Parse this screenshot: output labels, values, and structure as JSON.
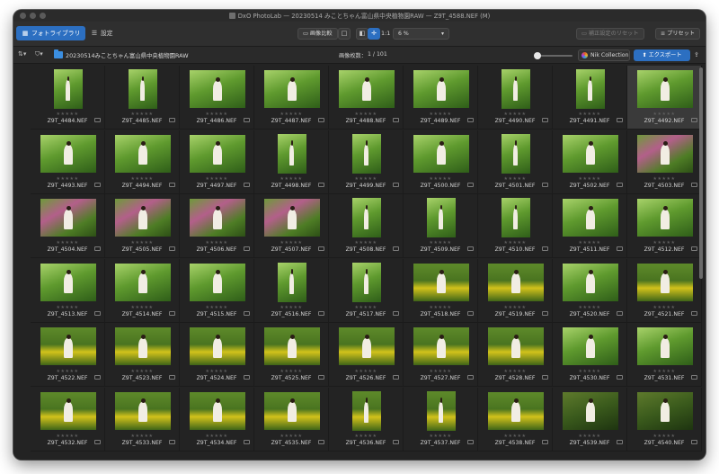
{
  "window": {
    "title": "DxO PhotoLab — 20230514 みことちゃん富山県中央植物園RAW — Z9T_4588.NEF (M)"
  },
  "toolbar": {
    "tab_library": "フォトライブラリ",
    "tab_customize": "設定",
    "compare_label": "画像比較",
    "zoom_one": "1:1",
    "zoom_value": "6 %",
    "reset_label": "補正設定のリセット",
    "presets_label": "プリセット"
  },
  "pathbar": {
    "path": "20230514みことちゃん富山県中央植物園RAW",
    "count_label": "画像枚数：",
    "count_value": "1 / 101",
    "nik_label": "Nik Collection",
    "export_label": "エクスポート"
  },
  "grid": {
    "stars": "★★★★★",
    "rows": [
      [
        "Z9T_4484.NEF",
        "Z9T_4485.NEF",
        "Z9T_4486.NEF",
        "Z9T_4487.NEF",
        "Z9T_4488.NEF",
        "Z9T_4489.NEF",
        "Z9T_4490.NEF",
        "Z9T_4491.NEF",
        "Z9T_4492.NEF"
      ],
      [
        "Z9T_4493.NEF",
        "Z9T_4494.NEF",
        "Z9T_4497.NEF",
        "Z9T_4498.NEF",
        "Z9T_4499.NEF",
        "Z9T_4500.NEF",
        "Z9T_4501.NEF",
        "Z9T_4502.NEF",
        "Z9T_4503.NEF"
      ],
      [
        "Z9T_4504.NEF",
        "Z9T_4505.NEF",
        "Z9T_4506.NEF",
        "Z9T_4507.NEF",
        "Z9T_4508.NEF",
        "Z9T_4509.NEF",
        "Z9T_4510.NEF",
        "Z9T_4511.NEF",
        "Z9T_4512.NEF"
      ],
      [
        "Z9T_4513.NEF",
        "Z9T_4514.NEF",
        "Z9T_4515.NEF",
        "Z9T_4516.NEF",
        "Z9T_4517.NEF",
        "Z9T_4518.NEF",
        "Z9T_4519.NEF",
        "Z9T_4520.NEF",
        "Z9T_4521.NEF"
      ],
      [
        "Z9T_4522.NEF",
        "Z9T_4523.NEF",
        "Z9T_4524.NEF",
        "Z9T_4525.NEF",
        "Z9T_4526.NEF",
        "Z9T_4527.NEF",
        "Z9T_4528.NEF",
        "Z9T_4530.NEF",
        "Z9T_4531.NEF"
      ],
      [
        "Z9T_4532.NEF",
        "Z9T_4533.NEF",
        "Z9T_4534.NEF",
        "Z9T_4535.NEF",
        "Z9T_4536.NEF",
        "Z9T_4537.NEF",
        "Z9T_4538.NEF",
        "Z9T_4539.NEF",
        "Z9T_4540.NEF"
      ]
    ],
    "orientation": [
      [
        "v",
        "v",
        "h",
        "h",
        "h",
        "h",
        "v",
        "v",
        "h"
      ],
      [
        "h",
        "h",
        "h",
        "v",
        "v",
        "h",
        "v",
        "h",
        "h"
      ],
      [
        "h",
        "h",
        "h",
        "h",
        "v",
        "v",
        "v",
        "h",
        "h"
      ],
      [
        "h",
        "h",
        "h",
        "v",
        "v",
        "h",
        "h",
        "h",
        "h"
      ],
      [
        "h",
        "h",
        "h",
        "h",
        "h",
        "h",
        "h",
        "h",
        "h"
      ],
      [
        "h",
        "h",
        "h",
        "h",
        "v",
        "v",
        "h",
        "h",
        "h"
      ]
    ],
    "theme": [
      [
        "green",
        "green",
        "green",
        "green",
        "green",
        "green",
        "green",
        "green",
        "green"
      ],
      [
        "green",
        "green",
        "green",
        "green",
        "green",
        "green",
        "green",
        "green",
        "pink"
      ],
      [
        "pink",
        "pink",
        "pink",
        "pink",
        "green",
        "green",
        "green",
        "green",
        "green"
      ],
      [
        "green",
        "green",
        "green",
        "green",
        "green",
        "yellow",
        "yellow",
        "green",
        "yellow"
      ],
      [
        "yellow",
        "yellow",
        "yellow",
        "yellow",
        "yellow",
        "yellow",
        "yellow",
        "green",
        "green"
      ],
      [
        "yellow",
        "yellow",
        "yellow",
        "yellow",
        "yellow",
        "yellow",
        "yellow",
        "dark",
        "dark"
      ]
    ],
    "selected": [
      0,
      8
    ]
  },
  "colors": {
    "accent": "#2c6fc1",
    "background": "#232323",
    "toolbar": "#2f2f2f"
  }
}
